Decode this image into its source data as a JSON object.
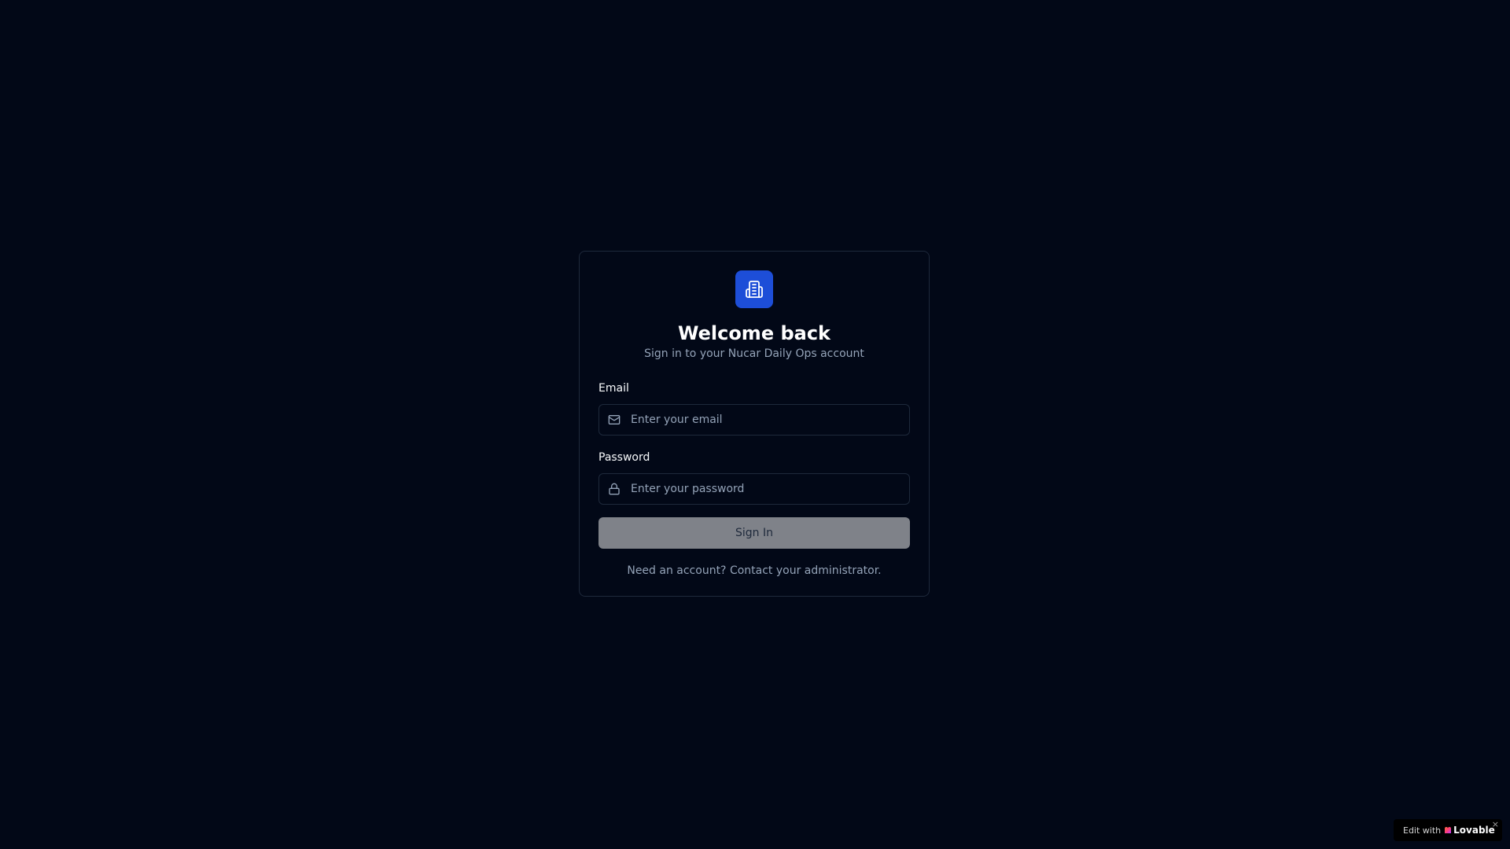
{
  "login": {
    "title": "Welcome back",
    "subtitle": "Sign in to your Nucar Daily Ops account",
    "logo_icon": "building-icon",
    "email": {
      "label": "Email",
      "placeholder": "Enter your email",
      "value": "",
      "icon": "mail-icon"
    },
    "password": {
      "label": "Password",
      "placeholder": "Enter your password",
      "value": "",
      "icon": "lock-icon"
    },
    "submit_label": "Sign In",
    "footer_text": "Need an account? Contact your administrator."
  },
  "badge": {
    "prefix": "Edit with",
    "brand": "Lovable",
    "close": "×"
  },
  "colors": {
    "background": "#020817",
    "accent": "#1d4ed8",
    "button_disabled": "#7f8289",
    "muted_text": "#94a3b8",
    "border": "#1e293b"
  }
}
